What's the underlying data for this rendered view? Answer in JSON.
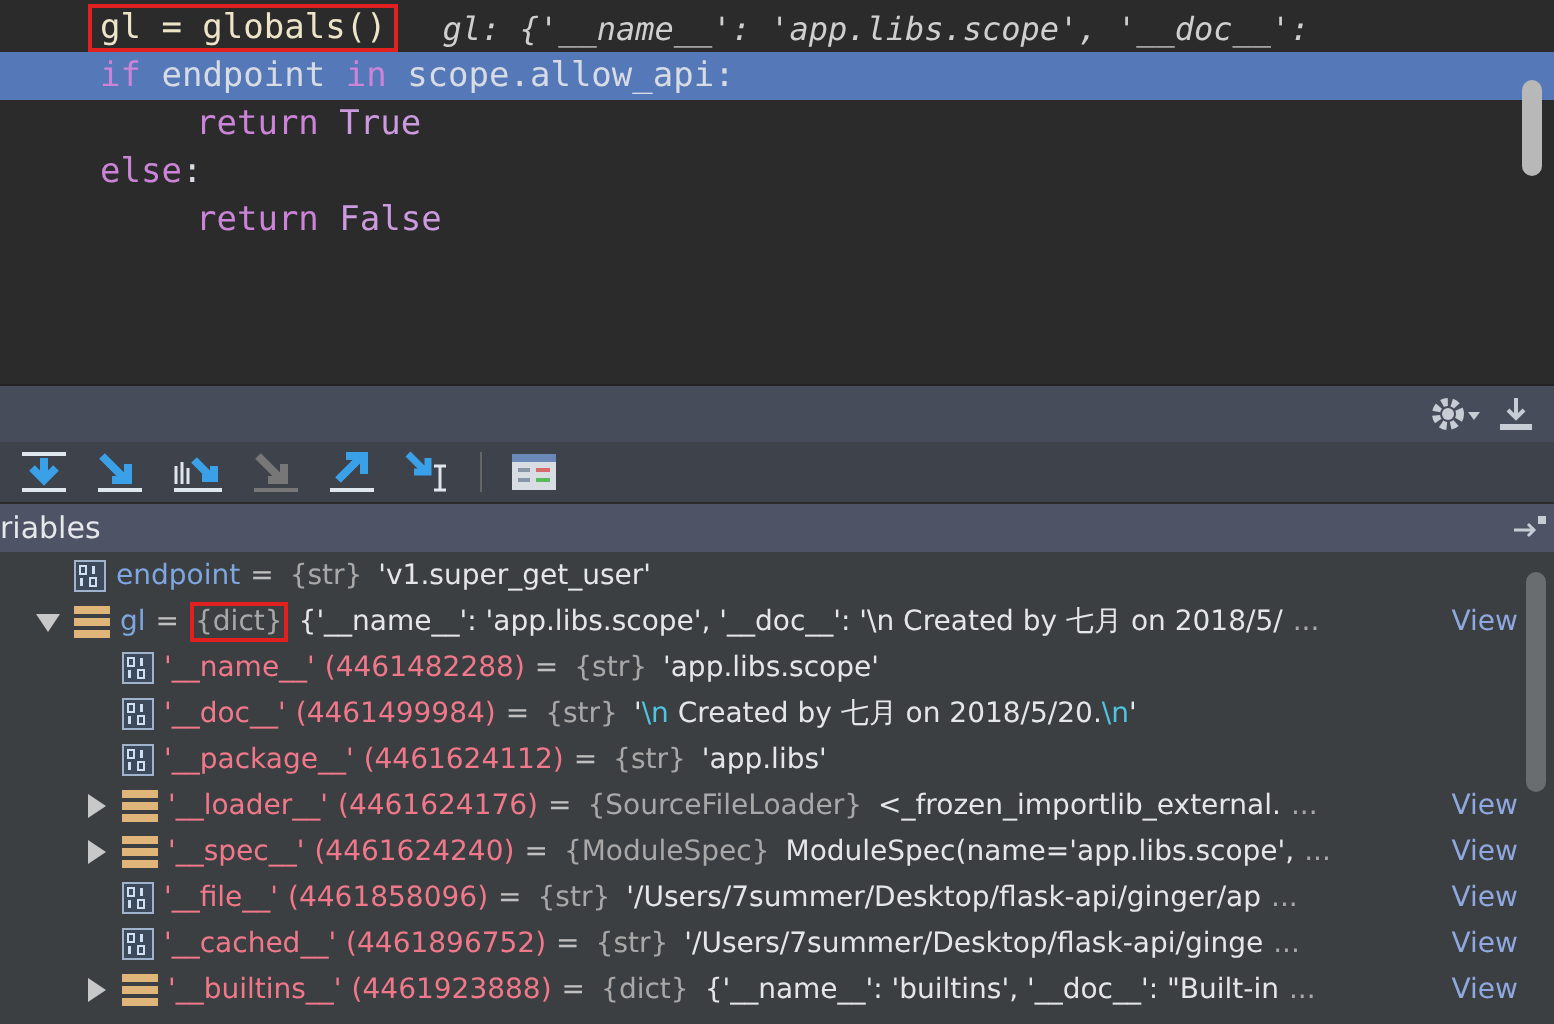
{
  "editor": {
    "lines": [
      {
        "selected": false,
        "tokens": [
          {
            "text": "gl = globals()",
            "kind": "plain",
            "boxed": true
          }
        ],
        "hint": "gl: {'__name__': 'app.libs.scope', '__doc__':"
      },
      {
        "selected": true,
        "tokens": [
          {
            "text": "if",
            "kind": "keyword",
            "boxed": false
          },
          {
            "text": " endpoint ",
            "kind": "plain",
            "boxed": false
          },
          {
            "text": "in",
            "kind": "keyword",
            "boxed": false
          },
          {
            "text": " scope.allow_api:",
            "kind": "plain",
            "boxed": false
          }
        ],
        "children": [
          {
            "selected": false,
            "tokens": [
              {
                "text": "return",
                "kind": "keyword",
                "boxed": false
              },
              {
                "text": " True",
                "kind": "constant",
                "boxed": false
              }
            ]
          }
        ]
      },
      {
        "selected": false,
        "tokens": [
          {
            "text": "else",
            "kind": "keyword",
            "boxed": false
          },
          {
            "text": ":",
            "kind": "plain",
            "boxed": false
          }
        ],
        "children": [
          {
            "selected": false,
            "tokens": [
              {
                "text": "return",
                "kind": "keyword",
                "boxed": false
              },
              {
                "text": " False",
                "kind": "constant",
                "boxed": false
              }
            ]
          }
        ]
      }
    ]
  },
  "variables": {
    "title": "riables",
    "rows": [
      {
        "name": "endpoint",
        "kind": "str",
        "sep": "=",
        "type": "{str}",
        "type_boxed": false,
        "value": [
          {
            "text": "'v1.super_get_user'",
            "kind": "plain"
          }
        ]
      },
      {
        "name": "gl",
        "kind": "dict",
        "sep": "=",
        "type": "{dict}",
        "type_boxed": true,
        "value": [
          {
            "text": "{'__name__': 'app.libs.scope', '__doc__': '\\n Created by 七月 on 2018/5/",
            "kind": "plain"
          }
        ],
        "more": "...",
        "link": "View",
        "expanded": true,
        "children": [
          {
            "name": "'__name__'",
            "kind": "str",
            "id": "(4461482288)",
            "sep": "=",
            "type": "{str}",
            "type_boxed": false,
            "value": [
              {
                "text": "'app.libs.scope'",
                "kind": "plain"
              }
            ]
          },
          {
            "name": "'__doc__'",
            "kind": "str",
            "id": "(4461499984)",
            "sep": "=",
            "type": "{str}",
            "type_boxed": false,
            "value": [
              {
                "text": "'",
                "kind": "plain"
              },
              {
                "text": "\\n",
                "kind": "escape"
              },
              {
                "text": " Created by 七月 on 2018/5/20.",
                "kind": "plain"
              },
              {
                "text": "\\n",
                "kind": "escape"
              },
              {
                "text": "'",
                "kind": "plain"
              }
            ]
          },
          {
            "name": "'__package__'",
            "kind": "str",
            "id": "(4461624112)",
            "sep": "=",
            "type": "{str}",
            "type_boxed": false,
            "value": [
              {
                "text": "'app.libs'",
                "kind": "plain"
              }
            ]
          },
          {
            "name": "'__loader__'",
            "kind": "object",
            "id": "(4461624176)",
            "sep": "=",
            "type": "{SourceFileLoader}",
            "type_boxed": false,
            "value": [
              {
                "text": "<_frozen_importlib_external.",
                "kind": "plain"
              }
            ],
            "more": "...",
            "link": "View",
            "expanded": false
          },
          {
            "name": "'__spec__'",
            "kind": "object",
            "id": "(4461624240)",
            "sep": "=",
            "type": "{ModuleSpec}",
            "type_boxed": false,
            "value": [
              {
                "text": "ModuleSpec(name='app.libs.scope',",
                "kind": "plain"
              }
            ],
            "more": "...",
            "link": "View",
            "expanded": false
          },
          {
            "name": "'__file__'",
            "kind": "str",
            "id": "(4461858096)",
            "sep": "=",
            "type": "{str}",
            "type_boxed": false,
            "value": [
              {
                "text": "'/Users/7summer/Desktop/flask-api/ginger/ap",
                "kind": "plain"
              }
            ],
            "more": "...",
            "link": "View"
          },
          {
            "name": "'__cached__'",
            "kind": "str",
            "id": "(4461896752)",
            "sep": "=",
            "type": "{str}",
            "type_boxed": false,
            "value": [
              {
                "text": "'/Users/7summer/Desktop/flask-api/ginge",
                "kind": "plain"
              }
            ],
            "more": "...",
            "link": "View"
          },
          {
            "name": "'__builtins__'",
            "kind": "dict",
            "id": "(4461923888)",
            "sep": "=",
            "type": "{dict}",
            "type_boxed": false,
            "value": [
              {
                "text": "{'__name__': 'builtins', '__doc__': \"Built-in",
                "kind": "plain"
              }
            ],
            "more": "...",
            "link": "View",
            "expanded": false
          }
        ]
      }
    ]
  }
}
